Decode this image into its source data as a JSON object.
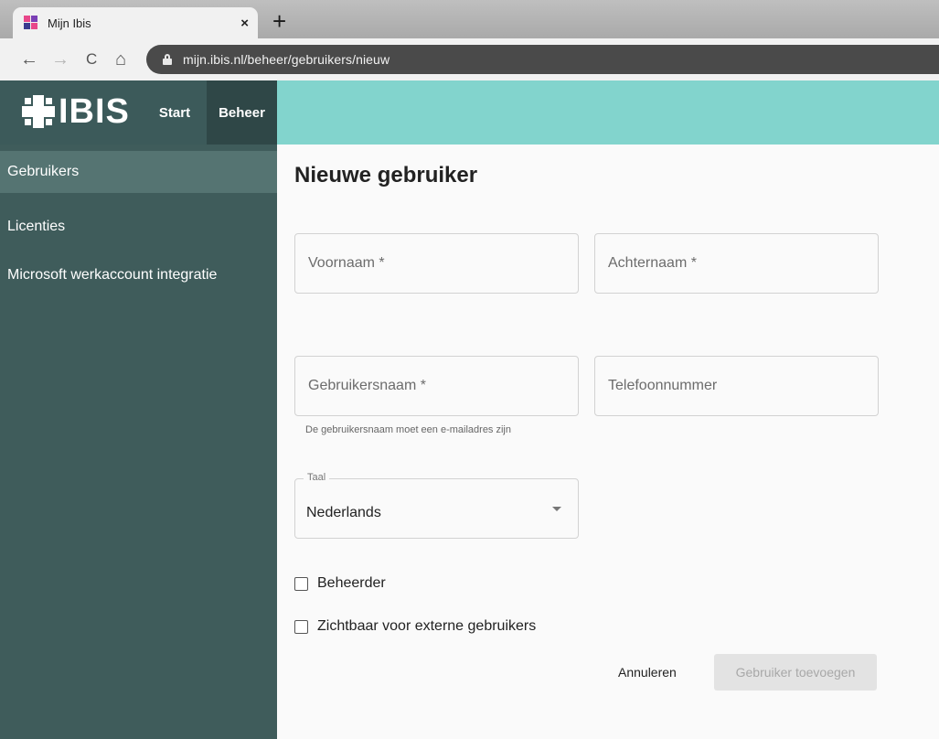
{
  "browser": {
    "tab_title": "Mijn Ibis",
    "tab_close": "×",
    "new_tab": "+",
    "back": "←",
    "forward": "→",
    "reload": "C",
    "home": "⌂",
    "url": "mijn.ibis.nl/beheer/gebruikers/nieuw"
  },
  "header": {
    "logo_text": "IBIS",
    "nav": [
      {
        "label": "Start",
        "active": false
      },
      {
        "label": "Beheer",
        "active": true
      }
    ]
  },
  "sidebar": {
    "items": [
      {
        "label": "Gebruikers",
        "active": true
      },
      {
        "label": "Licenties",
        "active": false
      },
      {
        "label": "Microsoft werkaccount integratie",
        "active": false
      }
    ]
  },
  "form": {
    "title": "Nieuwe gebruiker",
    "first_name": {
      "placeholder": "Voornaam *",
      "value": ""
    },
    "last_name": {
      "placeholder": "Achternaam *",
      "value": ""
    },
    "username": {
      "placeholder": "Gebruikersnaam *",
      "value": "",
      "helper": "De gebruikersnaam moet een e-mailadres zijn"
    },
    "phone": {
      "placeholder": "Telefoonnummer",
      "value": ""
    },
    "language": {
      "label": "Taal",
      "value": "Nederlands"
    },
    "admin_checkbox": {
      "label": "Beheerder",
      "checked": false
    },
    "external_checkbox": {
      "label": "Zichtbaar voor externe gebruikers",
      "checked": false
    },
    "cancel_label": "Annuleren",
    "submit_label": "Gebruiker toevoegen"
  },
  "colors": {
    "header_teal": "#82d4cd",
    "sidebar_dark": "#3f5c5b",
    "sidebar_active": "#557472",
    "nav_active": "#2f4747"
  }
}
